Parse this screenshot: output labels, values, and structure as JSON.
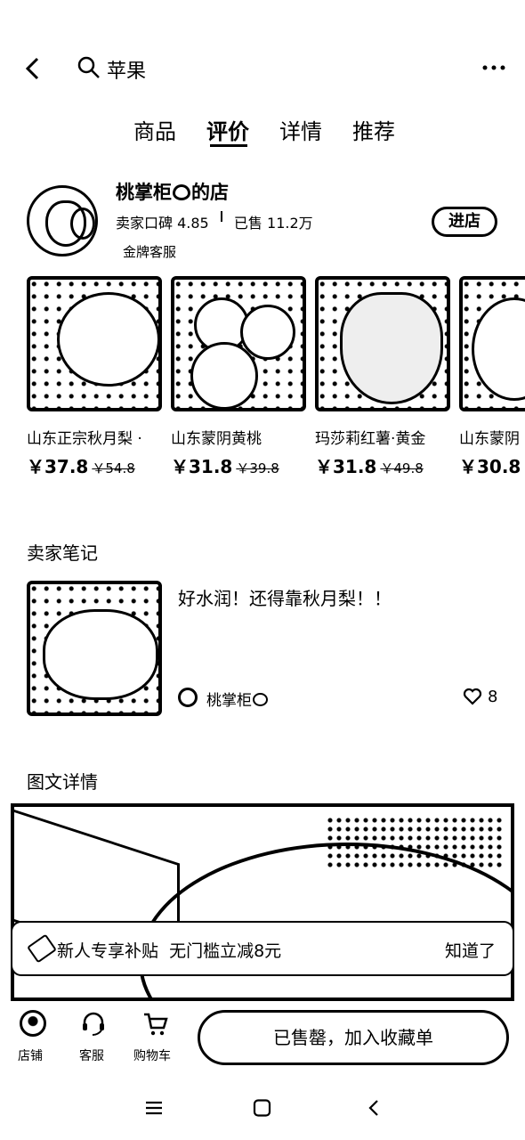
{
  "search": {
    "query": "苹果"
  },
  "tabs": [
    {
      "label": "商品"
    },
    {
      "label": "评价"
    },
    {
      "label": "详情"
    },
    {
      "label": "推荐"
    }
  ],
  "shop": {
    "name": "桃掌柜",
    "name_suffix": "的店",
    "rating_label": "卖家口碑",
    "rating": "4.85",
    "sold_label": "已售",
    "sold": "11.2万",
    "badge": "金牌客服",
    "enter_button": "进店"
  },
  "products": [
    {
      "name": "山东正宗秋月梨 ·",
      "price": "￥37.8",
      "old_price": "￥54.8"
    },
    {
      "name": "山东蒙阴黄桃",
      "price": "￥31.8",
      "old_price": "￥39.8"
    },
    {
      "name": "玛莎莉红薯·黄金",
      "price": "￥31.8",
      "old_price": "￥49.8"
    },
    {
      "name": "山东蒙阴",
      "price": "￥30.8",
      "old_price": ""
    }
  ],
  "notes": {
    "section_title": "卖家笔记",
    "note_text": "好水润！还得靠秋月梨！！",
    "author": "桃掌柜",
    "likes": "8"
  },
  "details": {
    "section_title": "图文详情"
  },
  "coupon_banner": {
    "text": "新人专享补贴  无门槛立减8元",
    "action": "知道了"
  },
  "bottom_bar": {
    "shop_label": "店铺",
    "service_label": "客服",
    "cart_label": "购物车",
    "buy_button": "已售罄，加入收藏单"
  }
}
